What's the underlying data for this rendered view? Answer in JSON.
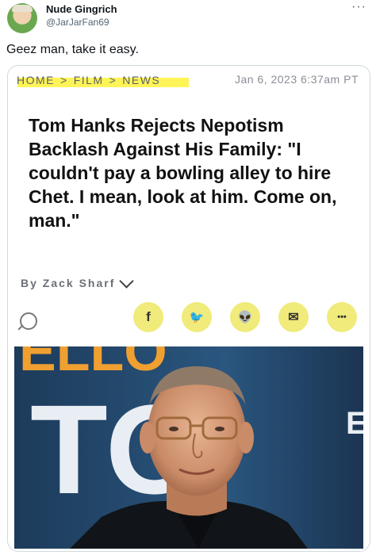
{
  "tweet": {
    "display_name": "Nude Gingrich",
    "handle": "@JarJarFan69",
    "more_icon": "more-dots-icon",
    "text": "Geez man, take it easy."
  },
  "article": {
    "breadcrumb": [
      "HOME",
      "FILM",
      "NEWS"
    ],
    "breadcrumb_separator": ">",
    "date": "Jan 6, 2023 6:37am PT",
    "headline": "Tom Hanks Rejects Nepotism Backlash Against His Family: \"I couldn't pay a bowling alley to hire Chet. I mean, look at him. Come on, man.\"",
    "byline": "By Zack Sharf",
    "highlight_color": "#fff23a",
    "share_icons": [
      "facebook-icon",
      "twitter-icon",
      "reddit-icon",
      "email-icon",
      "more-icon"
    ],
    "share_glyphs": [
      "f",
      "🐦",
      "👽",
      "✉",
      "•••"
    ],
    "share_button_color": "#f0eb7a"
  },
  "photo": {
    "backdrop_letters": [
      "ELLO",
      "TO",
      "E"
    ]
  }
}
